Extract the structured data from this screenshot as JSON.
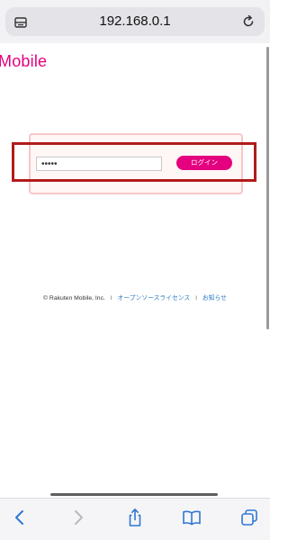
{
  "browser": {
    "url": "192.168.0.1"
  },
  "brand": {
    "logo_text": "Mobile",
    "color": "#e4007f"
  },
  "login": {
    "password_value": "•••••",
    "button_label": "ログイン"
  },
  "footer": {
    "copyright": "© Rakuten Mobile, Inc.",
    "separator": "I",
    "link_license": "オープンソースライセンス",
    "link_news": "お知らせ",
    "link_color": "#2a7ac6"
  },
  "highlight": {
    "color": "#b01c1c"
  },
  "toolbar": {
    "icons": [
      "back-icon",
      "forward-icon",
      "share-icon",
      "bookmarks-icon",
      "tabs-icon"
    ]
  }
}
